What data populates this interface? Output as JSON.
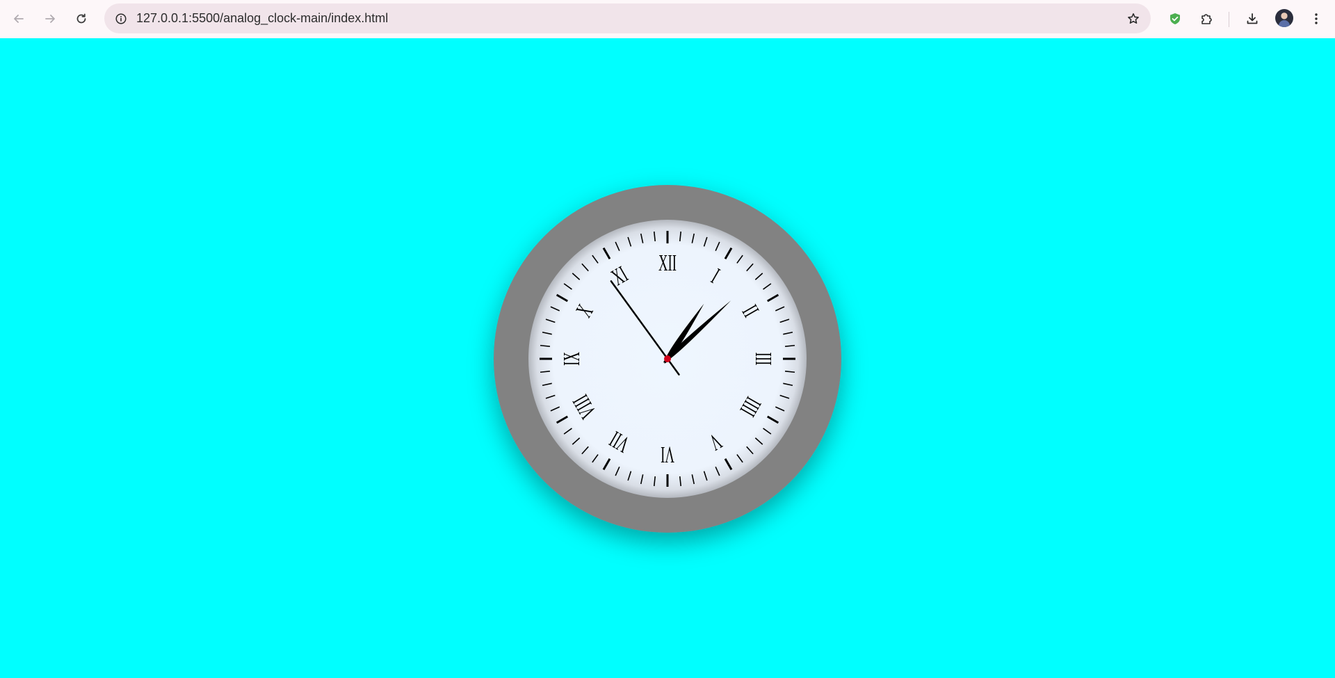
{
  "browser": {
    "url": "127.0.0.1:5500/analog_clock-main/index.html",
    "icons": [
      "back-arrow-icon",
      "forward-arrow-icon",
      "reload-icon",
      "site-info-icon",
      "bookmark-star-icon",
      "shield-extension-icon",
      "puzzle-extensions-icon",
      "download-icon",
      "profile-avatar",
      "more-menu-icon"
    ]
  },
  "colors": {
    "page_background": "#00ffff",
    "toolbar_background": "#fdf7f9",
    "omnibox_background": "#f1e4ea",
    "clock_bezel": "#828282",
    "clock_face": "#eef6ff",
    "hands": "#000000",
    "center_pin": "#d0021b"
  },
  "clock": {
    "numerals": [
      "XII",
      "I",
      "II",
      "III",
      "IIII",
      "V",
      "VI",
      "VII",
      "VIII",
      "IX",
      "X",
      "XI"
    ],
    "time": {
      "hour": 1,
      "minute": 7,
      "second": 54
    }
  }
}
